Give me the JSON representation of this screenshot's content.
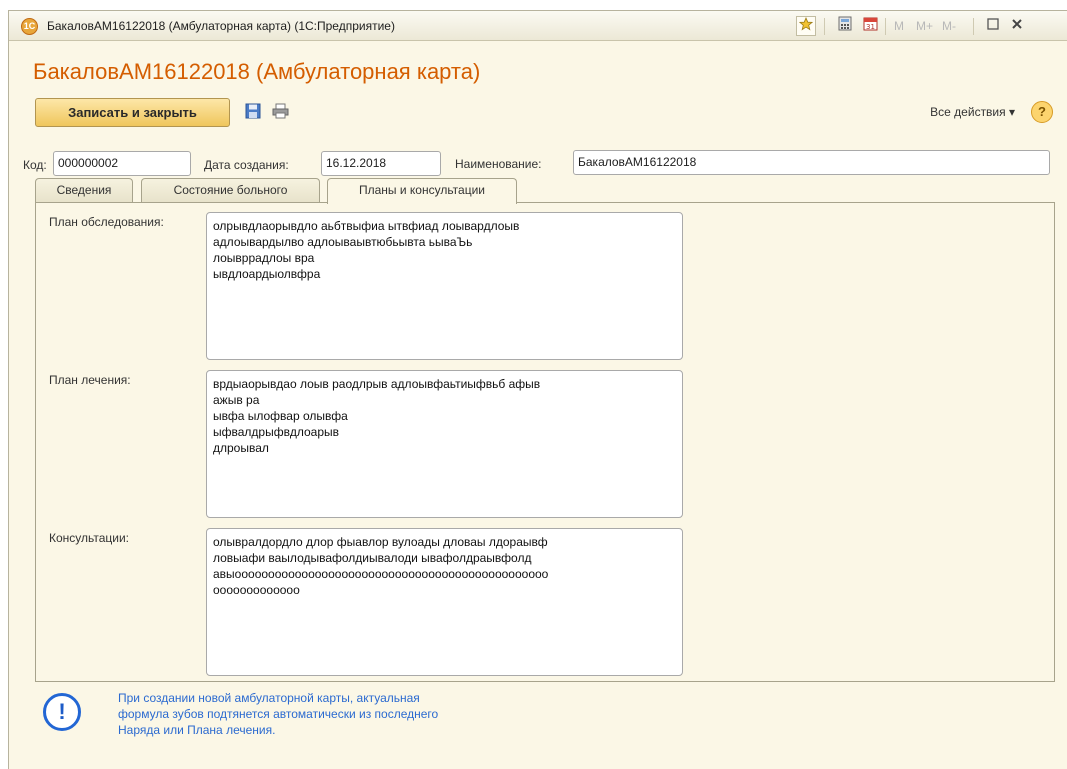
{
  "window": {
    "title": "БакаловАМ16122018 (Амбулаторная карта)  (1С:Предприятие)",
    "logo_text": "1С",
    "titlebar_icons": [
      "favorite-icon",
      "calculator-icon",
      "calendar-icon",
      "maximize-icon",
      "close-icon"
    ],
    "m_buttons": [
      "M",
      "M+",
      "M-"
    ]
  },
  "form": {
    "title": "БакаловАМ16122018 (Амбулаторная карта)"
  },
  "toolbar": {
    "save_close_label": "Записать и закрыть",
    "all_actions_label": "Все действия ▾",
    "help_label": "?"
  },
  "fields": {
    "code_label": "Код:",
    "code_value": "000000002",
    "date_label": "Дата создания:",
    "date_value": "16.12.2018",
    "name_label": "Наименование:",
    "name_value": "БакаловАМ16122018"
  },
  "tabs": [
    {
      "label": "Сведения",
      "active": false
    },
    {
      "label": "Состояние больного",
      "active": false
    },
    {
      "label": "Планы и консультации",
      "active": true
    }
  ],
  "panel": {
    "exam_plan_label": "План обследования:",
    "exam_plan_text": "олрывдлаорывдло аьбтвыфиа ытвфиад лоывардлоыв\nадлоывардылво адлоываывтюбьывта ьываЪь\nлоывррадлоы вра\nывдлоардыолвфра",
    "treatment_plan_label": "План лечения:",
    "treatment_plan_text": "врдыаорывдао лоыв раодлрыв адлоывфаьтиыфвьб афыв\nажыв ра\nывфа ылофвар олывфа\nыфвалдрыфвдлоарыв\nдлроывал",
    "consult_label": "Консультации:",
    "consult_text": "олывралдордло длор фыавлор вулоады дловаы лдораывф\nловыафи ваылодывафолдиывалоди ывафолдраывфолд\nавыооооооооооооооооооооооооооооооооооооооооооооооо\nооооооооооооо"
  },
  "info": {
    "icon_label": "!",
    "text": "При создании новой амбулаторной карты, актуальная\nформула зубов подтянется автоматически из последнего\nНаряда или Плана лечения."
  },
  "colors": {
    "title_orange": "#d45d00",
    "window_bg": "#fbf7e6",
    "primary_button": "#efc65c",
    "info_blue": "#2b6ad0"
  }
}
